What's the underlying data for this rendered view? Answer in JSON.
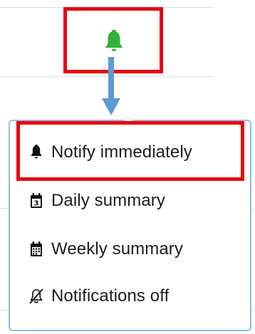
{
  "colors": {
    "bell_active": "#2eb23c",
    "highlight": "#e8060f",
    "arrow": "#5b9bd5",
    "menu_border": "#8fc0e6",
    "text": "#1d1d1d"
  },
  "notification_button": {
    "icon": "bell-icon",
    "state": "active"
  },
  "menu": {
    "items": [
      {
        "label": "Notify immediately",
        "icon": "bell-icon",
        "selected": true
      },
      {
        "label": "Daily summary",
        "icon": "calendar-day-icon",
        "icon_text": "3"
      },
      {
        "label": "Weekly summary",
        "icon": "calendar-week-icon"
      },
      {
        "label": "Notifications off",
        "icon": "bell-slash-icon"
      }
    ]
  }
}
